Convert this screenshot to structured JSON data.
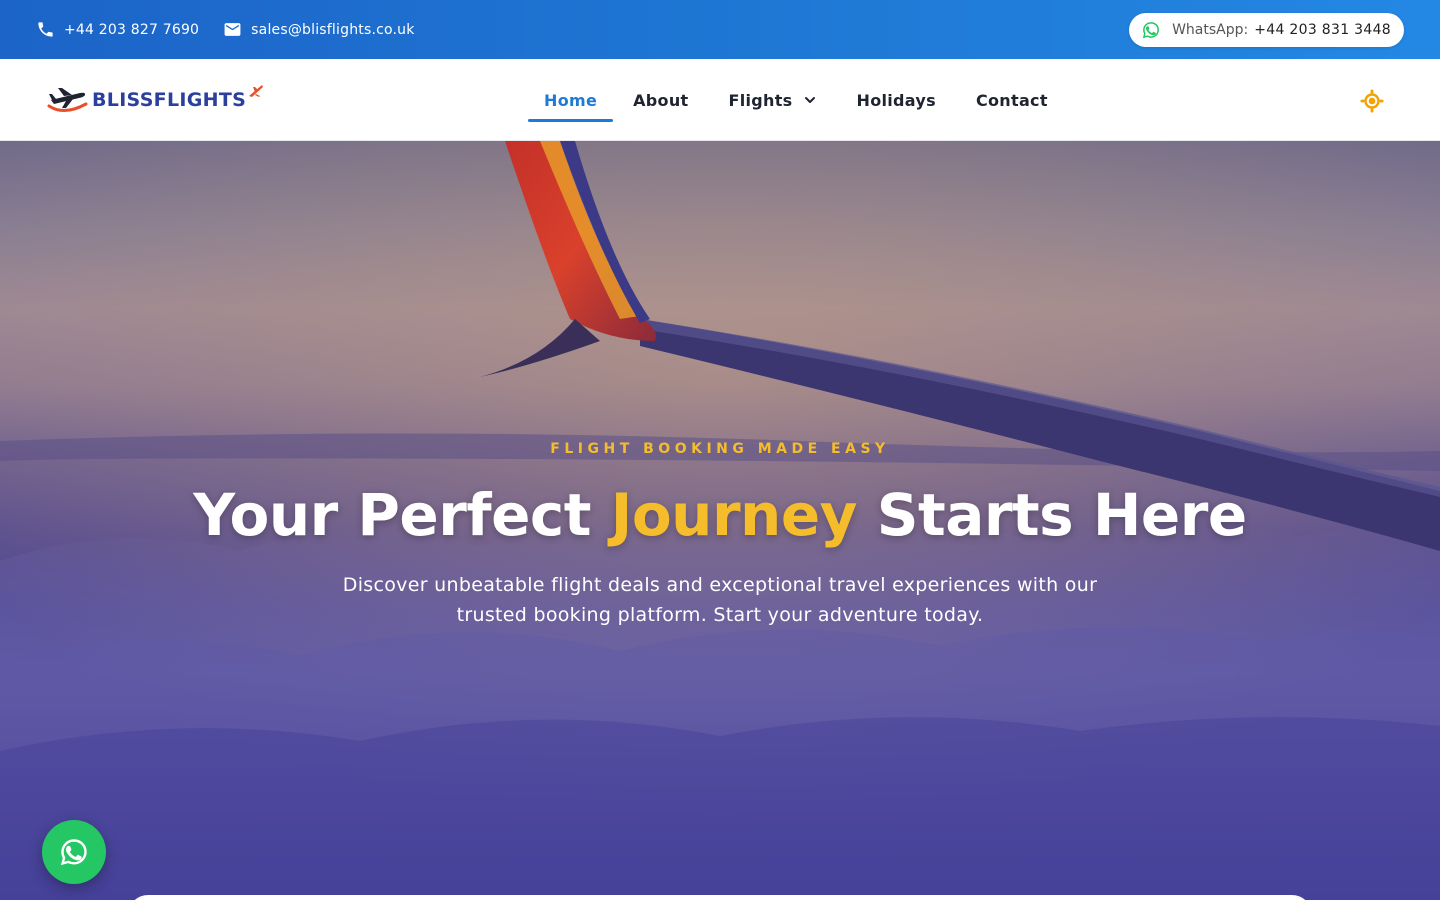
{
  "topbar": {
    "phone": "+44 203 827 7690",
    "email": "sales@blisflights.co.uk",
    "whatsapp_label": "WhatsApp:",
    "whatsapp_number": "+44 203 831 3448"
  },
  "brand": {
    "name": "BLISSFLIGHTS"
  },
  "nav": {
    "items": [
      {
        "label": "Home",
        "active": true
      },
      {
        "label": "About"
      },
      {
        "label": "Flights",
        "dropdown": true
      },
      {
        "label": "Holidays"
      },
      {
        "label": "Contact"
      }
    ]
  },
  "hero": {
    "kicker": "FLIGHT BOOKING MADE EASY",
    "headline_before": "Your Perfect ",
    "headline_accent": "Journey",
    "headline_after": " Starts Here",
    "subtext": "Discover unbeatable flight deals and exceptional travel experiences with our trusted booking platform. Start your adventure today."
  },
  "icons": {
    "phone": "phone-icon",
    "email": "mail-icon",
    "whatsapp": "whatsapp-icon",
    "theme": "sun-icon",
    "dropdown": "chevron-down-icon"
  },
  "colors": {
    "primary": "#1f7ad6",
    "accent": "#f5bd2c",
    "whatsapp": "#25c764",
    "nav_text": "#1f2430"
  }
}
